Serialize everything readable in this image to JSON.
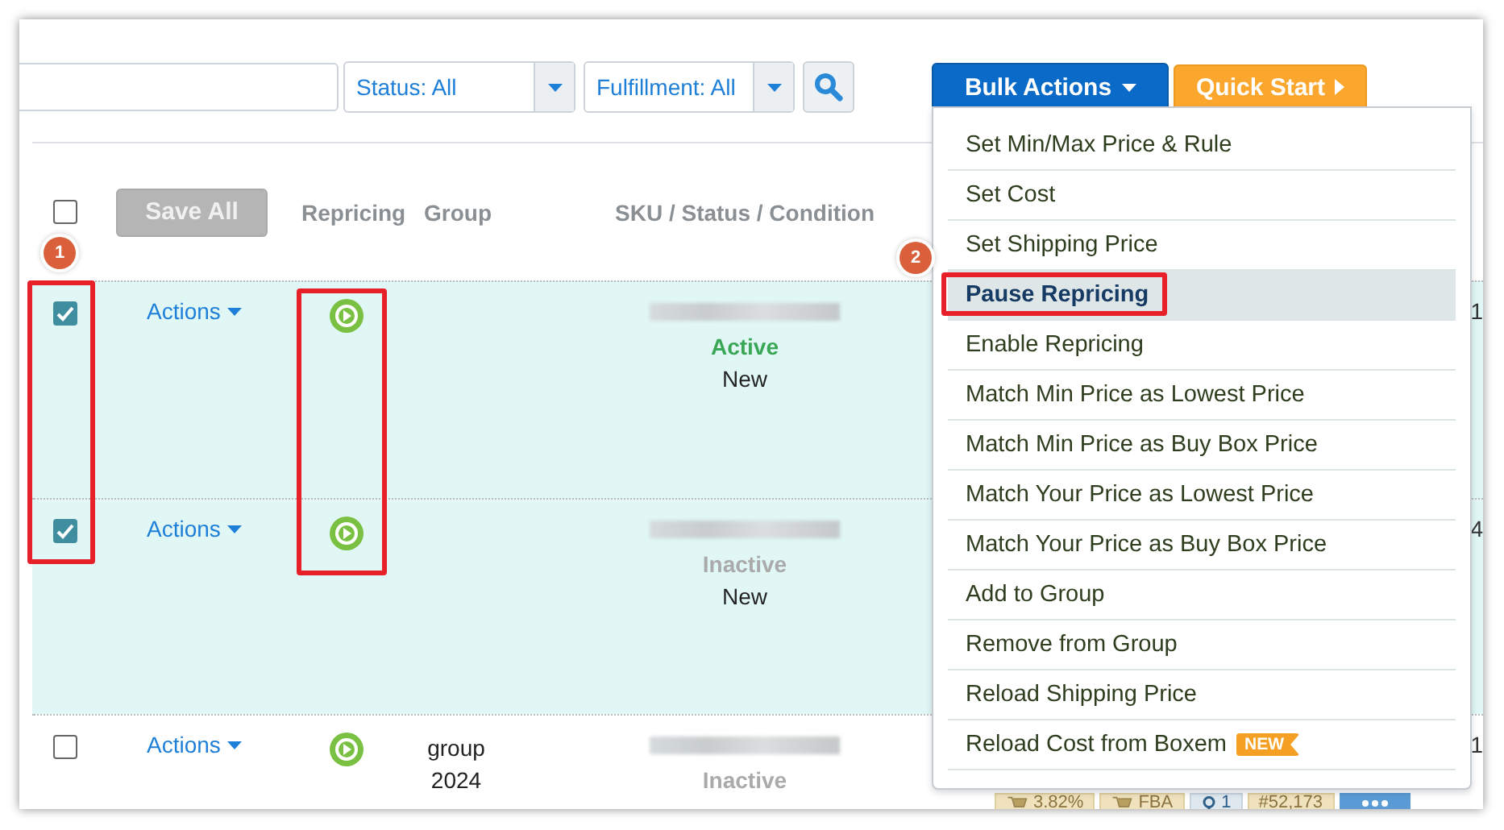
{
  "filters": [
    {
      "label": "Status: All"
    },
    {
      "label": "Fulfillment: All"
    }
  ],
  "bulk_actions": {
    "label": "Bulk Actions",
    "expanded": true
  },
  "quick_start": {
    "label": "Quick Start"
  },
  "save_all": {
    "label": "Save All",
    "disabled": true
  },
  "header": {
    "select_all_checked": false,
    "columns": [
      "Repricing",
      "Group",
      "SKU / Status / Condition"
    ]
  },
  "callouts": [
    "1",
    "2"
  ],
  "rows": [
    {
      "checked": true,
      "actions": "Actions",
      "group": [],
      "status": "Active",
      "status_active": true,
      "condition": "New",
      "edge_text": "1",
      "metrics": []
    },
    {
      "checked": true,
      "actions": "Actions",
      "group": [],
      "status": "Inactive",
      "status_active": false,
      "condition": "New",
      "edge_text": "4",
      "metrics": []
    },
    {
      "checked": false,
      "actions": "Actions",
      "group": [
        "group",
        "2024"
      ],
      "status": "Inactive",
      "status_active": false,
      "edge_text": "1",
      "metrics": [
        {
          "kind": "cart",
          "label": "3.82%"
        },
        {
          "kind": "cart",
          "label": "FBA"
        },
        {
          "kind": "pin",
          "label": "1"
        },
        {
          "kind": "plain",
          "label": "#52,173"
        },
        {
          "kind": "more"
        }
      ]
    }
  ],
  "menu": [
    {
      "label": "Set Min/Max Price & Rule",
      "selected": false
    },
    {
      "label": "Set Cost",
      "selected": false
    },
    {
      "label": "Set Shipping Price",
      "selected": false
    },
    {
      "label": "Pause Repricing",
      "selected": true
    },
    {
      "label": "Enable Repricing",
      "selected": false
    },
    {
      "label": "Match Min Price as Lowest Price",
      "selected": false
    },
    {
      "label": "Match Min Price as Buy Box Price",
      "selected": false
    },
    {
      "label": "Match Your Price as Lowest Price",
      "selected": false
    },
    {
      "label": "Match Your Price as Buy Box Price",
      "selected": false
    },
    {
      "label": "Add to Group",
      "selected": false
    },
    {
      "label": "Remove from Group",
      "selected": false
    },
    {
      "label": "Reload Shipping Price",
      "selected": false
    },
    {
      "label": "Reload Cost from Boxem",
      "selected": false,
      "badge": "NEW"
    }
  ]
}
